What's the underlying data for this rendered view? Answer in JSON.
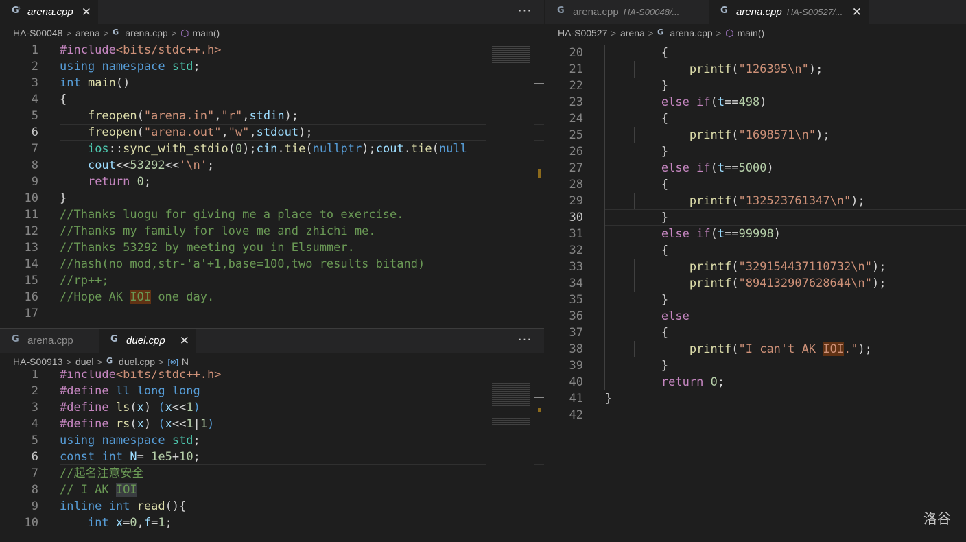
{
  "top_left": {
    "tabs": [
      {
        "icon": "cpp-file-icon",
        "name": "arena.cpp",
        "close": "✕"
      }
    ],
    "more": "···",
    "breadcrumb": {
      "folder": "HA-S00048",
      "sub": "arena",
      "file": "arena.cpp",
      "symbol": "main()"
    },
    "lines": [
      {
        "n": "1",
        "html": "<span class='pp'>#include</span><span class='st'>&lt;bits/stdc++.h&gt;</span>"
      },
      {
        "n": "2",
        "html": "<span class='ty'>using</span> <span class='ty'>namespace</span> <span class='ns'>std</span><span class='pl'>;</span>"
      },
      {
        "n": "3",
        "html": "<span class='ty'>int</span> <span class='fn'>main</span><span class='pl'>()</span>"
      },
      {
        "n": "4",
        "html": "<span class='pl'>{</span>"
      },
      {
        "n": "5",
        "html": "    <span class='fn'>freopen</span><span class='pl'>(</span><span class='st'>\"arena.in\"</span><span class='pl'>,</span><span class='st'>\"r\"</span><span class='pl'>,</span><span class='vr'>stdin</span><span class='pl'>);</span>"
      },
      {
        "n": "6",
        "html": "    <span class='fn'>freopen</span><span class='pl'>(</span><span class='st'>\"arena.out\"</span><span class='pl'>,</span><span class='st'>\"w\"</span><span class='pl'>,</span><span class='vr'>stdout</span><span class='pl'>);</span>",
        "cur": true
      },
      {
        "n": "7",
        "html": "    <span class='ns'>ios</span><span class='pl'>::</span><span class='fn'>sync_with_stdio</span><span class='pl'>(</span><span class='nu'>0</span><span class='pl'>);</span><span class='vr'>cin</span><span class='pl'>.</span><span class='fn'>tie</span><span class='pl'>(</span><span class='ty'>nullptr</span><span class='pl'>);</span><span class='vr'>cout</span><span class='pl'>.</span><span class='fn'>tie</span><span class='pl'>(</span><span class='ty'>null</span>"
      },
      {
        "n": "8",
        "html": "    <span class='vr'>cout</span><span class='pl'>&lt;&lt;</span><span class='nu'>53292</span><span class='pl'>&lt;&lt;</span><span class='st'>'\\n'</span><span class='pl'>;</span>"
      },
      {
        "n": "9",
        "html": "    <span class='kw'>return</span> <span class='nu'>0</span><span class='pl'>;</span>"
      },
      {
        "n": "10",
        "html": "<span class='pl'>}</span>"
      },
      {
        "n": "11",
        "html": "<span class='cm'>//Thanks luogu for giving me a place to exercise.</span>"
      },
      {
        "n": "12",
        "html": "<span class='cm'>//Thanks my family for love me and zhichi me.</span>"
      },
      {
        "n": "13",
        "html": "<span class='cm'>//Thanks 53292 by meeting you in Elsummer.</span>"
      },
      {
        "n": "14",
        "html": "<span class='cm'>//hash(no mod,str-'a'+1,base=100,two results bitand)</span>"
      },
      {
        "n": "15",
        "html": "<span class='cm'>//rp++;</span>"
      },
      {
        "n": "16",
        "html": "<span class='cm'>//Hope AK <span class='hl'>IOI</span> one day.</span>"
      },
      {
        "n": "17",
        "html": ""
      }
    ]
  },
  "bottom_left": {
    "tabs": [
      {
        "icon": "cpp-file-icon",
        "name": "arena.cpp"
      },
      {
        "icon": "cpp-file-icon",
        "name": "duel.cpp",
        "close": "✕"
      }
    ],
    "more": "···",
    "breadcrumb": {
      "folder": "HA-S00913",
      "sub": "duel",
      "file": "duel.cpp",
      "symbol_icon": "[⊚]",
      "symbol": "N"
    },
    "lines": [
      {
        "n": "1",
        "html": "<span class='pp'>#include</span><span class='st'>&lt;bits/stdc++.h&gt;</span>"
      },
      {
        "n": "2",
        "html": "<span class='pp'>#define</span> <span class='ty'>ll</span> <span class='ty'>long long</span>"
      },
      {
        "n": "3",
        "html": "<span class='pp'>#define</span> <span class='fn'>ls</span><span class='pl'>(</span><span class='vr'>x</span><span class='pl'>)</span> <span class='ty'>(</span><span class='vr'>x</span><span class='pl'>&lt;&lt;</span><span class='nu'>1</span><span class='ty'>)</span>"
      },
      {
        "n": "4",
        "html": "<span class='pp'>#define</span> <span class='fn'>rs</span><span class='pl'>(</span><span class='vr'>x</span><span class='pl'>)</span> <span class='ty'>(</span><span class='vr'>x</span><span class='pl'>&lt;&lt;</span><span class='nu'>1</span><span class='pl'>|</span><span class='nu'>1</span><span class='ty'>)</span>"
      },
      {
        "n": "5",
        "html": "<span class='ty'>using</span> <span class='ty'>namespace</span> <span class='ns'>std</span><span class='pl'>;</span>"
      },
      {
        "n": "6",
        "html": "<span class='ty'>const</span> <span class='ty'>int</span> <span class='vr'>N</span><span class='pl'>=</span> <span class='nu'>1e5</span><span class='pl'>+</span><span class='nu'>10</span><span class='pl'>;</span>",
        "cur": true
      },
      {
        "n": "7",
        "html": "<span class='cm'>//起名注意安全</span>"
      },
      {
        "n": "8",
        "html": "<span class='cm'>// I AK <span class='hl2'>IOI</span></span>"
      },
      {
        "n": "9",
        "html": "<span class='ty'>inline</span> <span class='ty'>int</span> <span class='fn'>read</span><span class='pl'>(){</span>"
      },
      {
        "n": "10",
        "html": "    <span class='ty'>int</span> <span class='vr'>x</span><span class='pl'>=</span><span class='nu'>0</span><span class='pl'>,</span><span class='vr'>f</span><span class='pl'>=</span><span class='nu'>1</span><span class='pl'>;</span>"
      }
    ]
  },
  "right": {
    "tabs": [
      {
        "icon": "cpp-file-icon",
        "name": "arena.cpp",
        "desc": "HA-S00048/..."
      },
      {
        "icon": "cpp-file-icon",
        "name": "arena.cpp",
        "desc": "HA-S00527/...",
        "close": "✕"
      }
    ],
    "breadcrumb": {
      "folder": "HA-S00527",
      "sub": "arena",
      "file": "arena.cpp",
      "symbol": "main()"
    },
    "lines": [
      {
        "n": "20",
        "html": "        <span class='pl'>{</span>"
      },
      {
        "n": "21",
        "html": "            <span class='fn'>printf</span><span class='pl'>(</span><span class='st'>\"126395\\n\"</span><span class='pl'>);</span>"
      },
      {
        "n": "22",
        "html": "        <span class='pl'>}</span>"
      },
      {
        "n": "23",
        "html": "        <span class='kw'>else</span> <span class='kw'>if</span><span class='pl'>(</span><span class='vr'>t</span><span class='pl'>==</span><span class='nu'>498</span><span class='pl'>)</span>"
      },
      {
        "n": "24",
        "html": "        <span class='pl'>{</span>"
      },
      {
        "n": "25",
        "html": "            <span class='fn'>printf</span><span class='pl'>(</span><span class='st'>\"1698571\\n\"</span><span class='pl'>);</span>"
      },
      {
        "n": "26",
        "html": "        <span class='pl'>}</span>"
      },
      {
        "n": "27",
        "html": "        <span class='kw'>else</span> <span class='kw'>if</span><span class='pl'>(</span><span class='vr'>t</span><span class='pl'>==</span><span class='nu'>5000</span><span class='pl'>)</span>"
      },
      {
        "n": "28",
        "html": "        <span class='pl'>{</span>"
      },
      {
        "n": "29",
        "html": "            <span class='fn'>printf</span><span class='pl'>(</span><span class='st'>\"132523761347\\n\"</span><span class='pl'>);</span>"
      },
      {
        "n": "30",
        "html": "        <span class='pl'>}</span>",
        "cur": true
      },
      {
        "n": "31",
        "html": "        <span class='kw'>else</span> <span class='kw'>if</span><span class='pl'>(</span><span class='vr'>t</span><span class='pl'>==</span><span class='nu'>99998</span><span class='pl'>)</span>"
      },
      {
        "n": "32",
        "html": "        <span class='pl'>{</span>"
      },
      {
        "n": "33",
        "html": "            <span class='fn'>printf</span><span class='pl'>(</span><span class='st'>\"329154437110732\\n\"</span><span class='pl'>);</span>"
      },
      {
        "n": "34",
        "html": "            <span class='fn'>printf</span><span class='pl'>(</span><span class='st'>\"894132907628644\\n\"</span><span class='pl'>);</span>"
      },
      {
        "n": "35",
        "html": "        <span class='pl'>}</span>"
      },
      {
        "n": "36",
        "html": "        <span class='kw'>else</span>"
      },
      {
        "n": "37",
        "html": "        <span class='pl'>{</span>"
      },
      {
        "n": "38",
        "html": "            <span class='fn'>printf</span><span class='pl'>(</span><span class='st'>\"I can't AK <span class='hl'>IOI</span>.\"</span><span class='pl'>);</span>"
      },
      {
        "n": "39",
        "html": "        <span class='pl'>}</span>"
      },
      {
        "n": "40",
        "html": "        <span class='kw'>return</span> <span class='nu'>0</span><span class='pl'>;</span>"
      },
      {
        "n": "41",
        "html": "<span class='pl'>}</span>"
      },
      {
        "n": "42",
        "html": ""
      }
    ]
  },
  "watermark": "洛谷",
  "colors": {
    "editor_bg": "#1e1e1e",
    "tabbar_bg": "#252526",
    "keyword": "#c586c0",
    "type": "#569cd6",
    "string": "#ce9178",
    "number": "#b5cea8",
    "comment": "#6a9955",
    "function": "#dcdcaa",
    "highlight": "#613214"
  }
}
